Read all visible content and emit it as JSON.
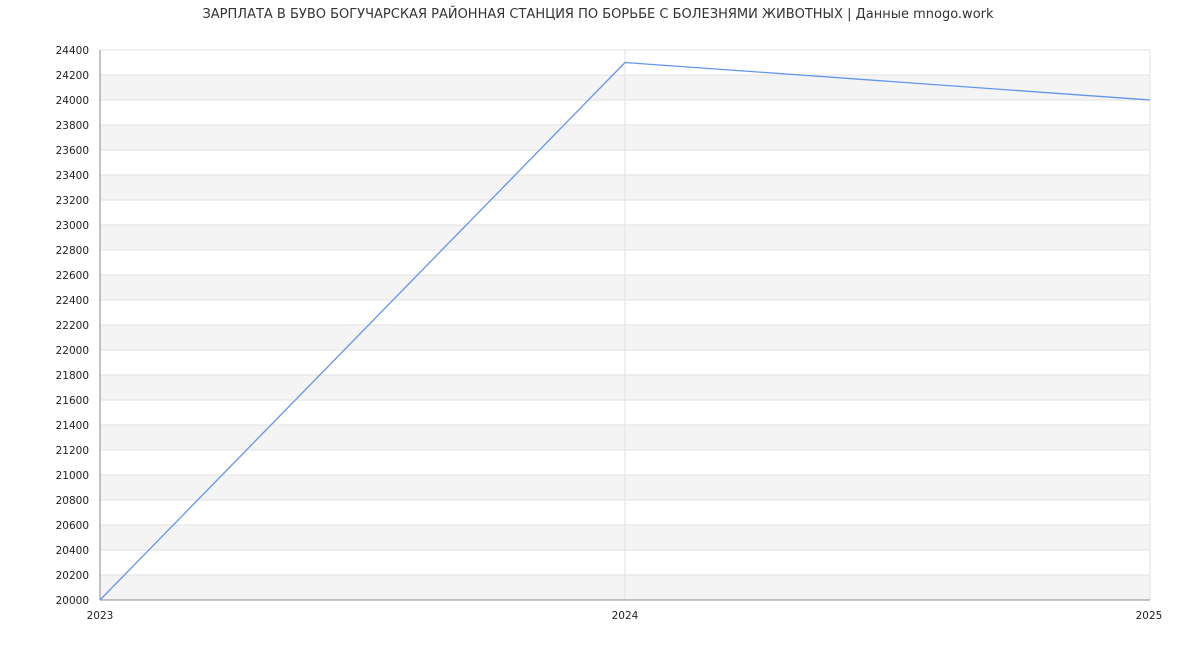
{
  "chart_data": {
    "type": "line",
    "title": "ЗАРПЛАТА В БУВО БОГУЧАРСКАЯ РАЙОННАЯ СТАНЦИЯ ПО БОРЬБЕ С БОЛЕЗНЯМИ ЖИВОТНЫХ | Данные mnogo.work",
    "xlabel": "",
    "ylabel": "",
    "x": [
      "2023",
      "2024",
      "2025"
    ],
    "series": [
      {
        "values": [
          20000,
          24300,
          24000
        ],
        "color": "#6495ed"
      }
    ],
    "ylim": [
      20000,
      24400
    ],
    "ytick_step": 200,
    "grid": true,
    "band_color": "#f4f4f4",
    "grid_color": "#e2e2e2",
    "axis_color": "#888888"
  }
}
